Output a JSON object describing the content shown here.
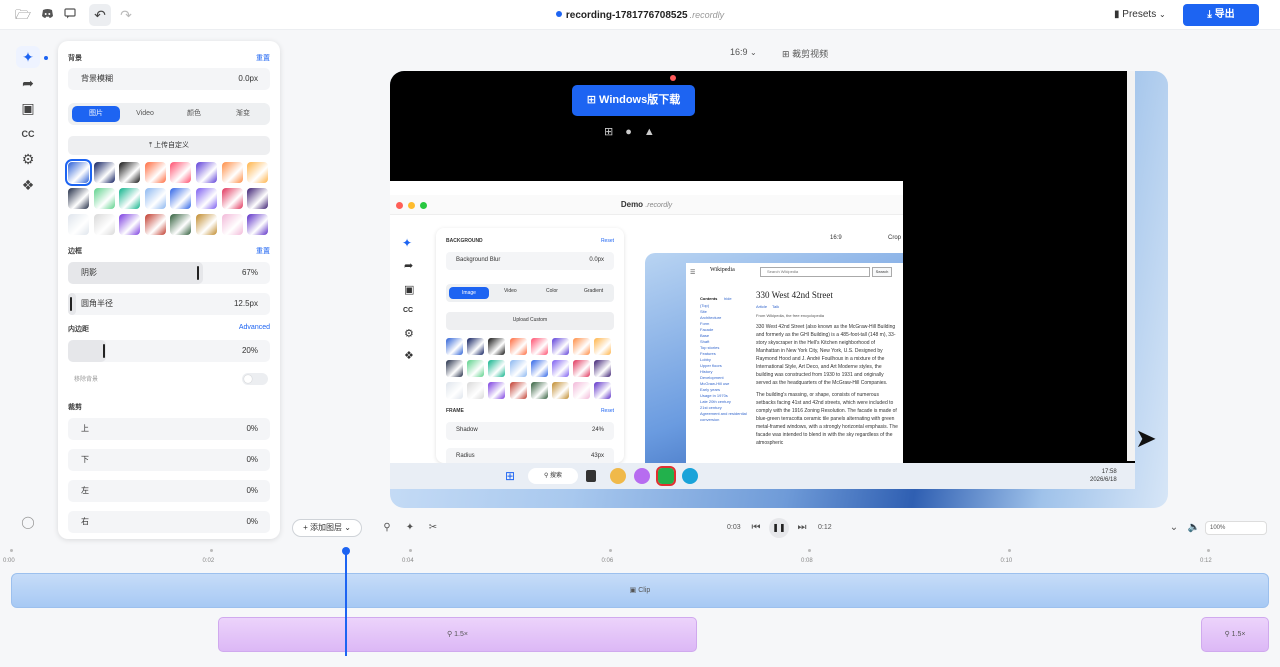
{
  "topbar": {
    "filename": "recording-1781776708525",
    "extension": ".recordly",
    "presets_label": "Presets",
    "export_label": "导出"
  },
  "panel": {
    "background": {
      "heading": "背景",
      "reset": "重置",
      "blur_label": "背景模糊",
      "blur_value": "0.0px",
      "tabs": [
        "图片",
        "Video",
        "颜色",
        "渐变"
      ],
      "upload_label": "上传自定义",
      "wallpapers": [
        "#2a5fd6",
        "#0b1a5c",
        "#111111",
        "#ff6a3d",
        "#ff4d6d",
        "#5c3dd8",
        "#ff8c42",
        "#ffb347",
        "#1f2a44",
        "#5bd18a",
        "#0fb38b",
        "#8ab6f0",
        "#2d63e6",
        "#7b5cf0",
        "#e0335a",
        "#3a1c71",
        "#dfe5ec",
        "#d9d9d9",
        "#7a3ce0",
        "#c0392b",
        "#2f5d3a",
        "#c08a2a",
        "#f2b8d8",
        "#5b2ec7"
      ]
    },
    "border": {
      "heading": "边框",
      "reset": "重置",
      "shadow_label": "阴影",
      "shadow_value": "67%",
      "shadow_level": 0.67,
      "radius_label": "圆角半径",
      "radius_value": "12.5px",
      "radius_level": 0.04
    },
    "padding": {
      "heading": "内边距",
      "advanced": "Advanced",
      "value": "20%",
      "level": 0.2,
      "remove_bg_label": "移除背景"
    },
    "crop": {
      "heading": "裁剪",
      "top_label": "上",
      "top_value": "0%",
      "bottom_label": "下",
      "bottom_value": "0%",
      "left_label": "左",
      "left_value": "0%",
      "right_label": "右",
      "right_value": "0%"
    }
  },
  "canvas_header": {
    "aspect": "16:9",
    "crop_video": "裁剪视频"
  },
  "preview": {
    "download_button": "Windows版下载",
    "inner_title": "Demo",
    "inner_title_ext": ".recordly",
    "inner_panel": {
      "background": "BACKGROUND",
      "reset": "Reset",
      "blur": "Background Blur",
      "blur_value": "0.0px",
      "tabs": [
        "Image",
        "Video",
        "Color",
        "Gradient"
      ],
      "upload": "Upload Custom",
      "frame": "FRAME",
      "frame_reset": "Reset",
      "shadow": "Shadow",
      "shadow_value": "24%",
      "radius": "Radius",
      "radius_value": "43px"
    },
    "inner_aspect": "16:9",
    "inner_crop": "Crop",
    "wiki_logo": "Wikipedia",
    "wiki_search": "Search Wikipedia",
    "wiki_search_btn": "Search",
    "wiki_title": "330 West 42nd Street",
    "wiki_tabs": [
      "Article",
      "Talk"
    ],
    "wiki_from": "From Wikipedia, the free encyclopedia",
    "wiki_contents": "Contents",
    "wiki_hide": "hide",
    "wiki_nav": [
      "(Top)",
      "Site",
      "Architecture",
      "Form",
      "Facade",
      "Base",
      "Shaft",
      "Top stories",
      "Features",
      "Lobby",
      "Upper floors",
      "History",
      "Development",
      "McGraw-Hill use",
      "Early years",
      "Usage in 1970s",
      "Late 20th century",
      "21st century",
      "Agreement and residential conversion"
    ],
    "wiki_p1": "330 West 42nd Street (also known as the McGraw-Hill Building and formerly as the GHI Building) is a 485-foot-tall (148 m), 33-story skyscraper in the Hell's Kitchen neighborhood of Manhattan in New York City, New York, U.S. Designed by Raymond Hood and J. André Fouilhoux in a mixture of the International Style, Art Deco, and Art Moderne styles, the building was constructed from 1930 to 1931 and originally served as the headquarters of the McGraw-Hill Companies.",
    "wiki_p2": "The building's massing, or shape, consists of numerous setbacks facing 41st and 42nd streets, which were included to comply with the 1916 Zoning Resolution. The facade is made of blue-green terracotta ceramic tile panels alternating with green metal-framed windows, with a strongly horizontal emphasis. The facade was intended to blend in with the sky regardless of the atmospheric",
    "taskbar_search": "搜索",
    "clock_time": "17:58",
    "clock_date": "2026/6/18"
  },
  "timeline": {
    "add_layer": "添加图层",
    "current_time": "0:03",
    "duration": "0:12",
    "zoom": "100%",
    "ruler": [
      "0:00",
      "0:02",
      "0:04",
      "0:06",
      "0:08",
      "0:10",
      "0:12"
    ],
    "clip_label": "Clip",
    "zoom_label_1": "1.5×",
    "zoom_label_2": "1.5×"
  },
  "colors": {
    "accent": "#1d64f2",
    "clip": "#a7c9f4",
    "zoom_segment": "#dcb8f6"
  }
}
